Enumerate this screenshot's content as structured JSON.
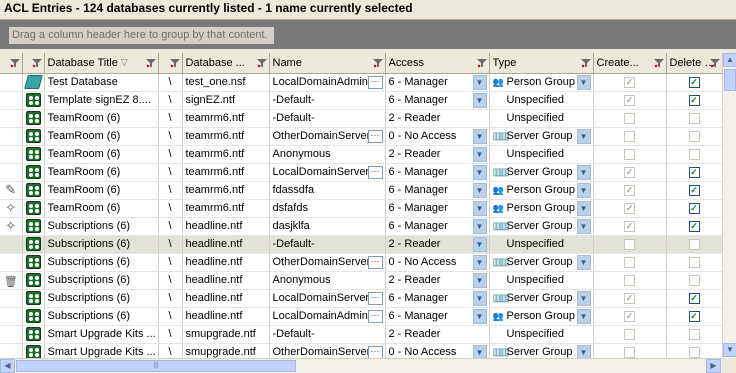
{
  "title": "ACL Entries - 124 databases currently listed - 1 name currently selected",
  "group_panel": {
    "placeholder": "Drag a column header here to group by that content."
  },
  "columns": [
    {
      "key": "marker",
      "label": ""
    },
    {
      "key": "icon",
      "label": ""
    },
    {
      "key": "db_title",
      "label": "Database Title"
    },
    {
      "key": "sep",
      "label": ""
    },
    {
      "key": "db_file",
      "label": "Database ..."
    },
    {
      "key": "name",
      "label": "Name"
    },
    {
      "key": "access",
      "label": "Access"
    },
    {
      "key": "type",
      "label": "Type"
    },
    {
      "key": "create",
      "label": "Create..."
    },
    {
      "key": "delete",
      "label": "Delete D..."
    }
  ],
  "rows": [
    {
      "marker": "",
      "icon": "db-teal",
      "db_title": "Test Database",
      "sep": "\\",
      "db_file": "test_one.nsf",
      "name": "LocalDomainAdmins",
      "name_btn": true,
      "access": "6 - Manager",
      "access_dd": true,
      "type": "Person Group",
      "type_icon": "person",
      "type_dd": true,
      "create": "checked-disabled",
      "delete": "checked"
    },
    {
      "marker": "",
      "icon": "db-green",
      "db_title": "Template signEZ 8....",
      "sep": "\\",
      "db_file": "signEZ.ntf",
      "name": "-Default-",
      "name_btn": false,
      "access": "6 - Manager",
      "access_dd": true,
      "type": "Unspecified",
      "type_icon": "",
      "type_dd": false,
      "create": "checked-disabled",
      "delete": "checked"
    },
    {
      "marker": "",
      "icon": "db-green",
      "db_title": "TeamRoom (6)",
      "sep": "\\",
      "db_file": "teamrm6.ntf",
      "name": "-Default-",
      "name_btn": false,
      "access": "2 - Reader",
      "access_dd": false,
      "type": "Unspecified",
      "type_icon": "",
      "type_dd": false,
      "create": "unchecked-disabled",
      "delete": "unchecked-disabled"
    },
    {
      "marker": "",
      "icon": "db-green",
      "db_title": "TeamRoom (6)",
      "sep": "\\",
      "db_file": "teamrm6.ntf",
      "name": "OtherDomainServers",
      "name_btn": true,
      "access": "0 - No Access",
      "access_dd": true,
      "type": "Server Group",
      "type_icon": "server",
      "type_dd": true,
      "create": "unchecked-disabled",
      "delete": "unchecked-disabled"
    },
    {
      "marker": "",
      "icon": "db-green",
      "db_title": "TeamRoom (6)",
      "sep": "\\",
      "db_file": "teamrm6.ntf",
      "name": "Anonymous",
      "name_btn": false,
      "access": "2 - Reader",
      "access_dd": true,
      "type": "Unspecified",
      "type_icon": "",
      "type_dd": false,
      "create": "unchecked-disabled",
      "delete": "unchecked-disabled"
    },
    {
      "marker": "",
      "icon": "db-green",
      "db_title": "TeamRoom (6)",
      "sep": "\\",
      "db_file": "teamrm6.ntf",
      "name": "LocalDomainServers",
      "name_btn": true,
      "access": "6 - Manager",
      "access_dd": true,
      "type": "Server Group",
      "type_icon": "server",
      "type_dd": true,
      "create": "checked-disabled",
      "delete": "checked"
    },
    {
      "marker": "pencil",
      "icon": "db-green",
      "db_title": "TeamRoom (6)",
      "sep": "\\",
      "db_file": "teamrm6.ntf",
      "name": "fdassdfa",
      "name_btn": false,
      "access": "6 - Manager",
      "access_dd": true,
      "type": "Person Group",
      "type_icon": "person",
      "type_dd": true,
      "create": "checked-disabled",
      "delete": "checked"
    },
    {
      "marker": "star",
      "icon": "db-green",
      "db_title": "TeamRoom (6)",
      "sep": "\\",
      "db_file": "teamrm6.ntf",
      "name": "dsfafds",
      "name_btn": false,
      "access": "6 - Manager",
      "access_dd": true,
      "type": "Person Group",
      "type_icon": "person",
      "type_dd": true,
      "create": "checked-disabled",
      "delete": "checked"
    },
    {
      "marker": "star",
      "icon": "db-green",
      "db_title": "Subscriptions (6)",
      "sep": "\\",
      "db_file": "headline.ntf",
      "name": "dasjklfa",
      "name_btn": false,
      "access": "6 - Manager",
      "access_dd": true,
      "type": "Server Group",
      "type_icon": "server",
      "type_dd": true,
      "create": "checked-disabled",
      "delete": "checked"
    },
    {
      "marker": "",
      "icon": "db-green",
      "db_title": "Subscriptions (6)",
      "sep": "\\",
      "db_file": "headline.ntf",
      "name": "-Default-",
      "name_btn": false,
      "access": "2 - Reader",
      "access_dd": true,
      "type": "Unspecified",
      "type_icon": "",
      "type_dd": false,
      "create": "unchecked-disabled",
      "delete": "unchecked-disabled",
      "selected": true
    },
    {
      "marker": "",
      "icon": "db-green",
      "db_title": "Subscriptions (6)",
      "sep": "\\",
      "db_file": "headline.ntf",
      "name": "OtherDomainServers",
      "name_btn": true,
      "access": "0 - No Access",
      "access_dd": true,
      "type": "Server Group",
      "type_icon": "server",
      "type_dd": true,
      "create": "unchecked-disabled",
      "delete": "unchecked-disabled"
    },
    {
      "marker": "trash",
      "icon": "db-green",
      "db_title": "Subscriptions (6)",
      "sep": "\\",
      "db_file": "headline.ntf",
      "name": "Anonymous",
      "name_btn": false,
      "access": "2 - Reader",
      "access_dd": true,
      "type": "Unspecified",
      "type_icon": "",
      "type_dd": false,
      "create": "unchecked-disabled",
      "delete": "unchecked-disabled"
    },
    {
      "marker": "",
      "icon": "db-green",
      "db_title": "Subscriptions (6)",
      "sep": "\\",
      "db_file": "headline.ntf",
      "name": "LocalDomainServers",
      "name_btn": true,
      "access": "6 - Manager",
      "access_dd": true,
      "type": "Server Group",
      "type_icon": "server",
      "type_dd": true,
      "create": "checked-disabled",
      "delete": "checked"
    },
    {
      "marker": "",
      "icon": "db-green",
      "db_title": "Subscriptions (6)",
      "sep": "\\",
      "db_file": "headline.ntf",
      "name": "LocalDomainAdmins",
      "name_btn": true,
      "access": "6 - Manager",
      "access_dd": true,
      "type": "Person Group",
      "type_icon": "person",
      "type_dd": true,
      "create": "checked-disabled",
      "delete": "checked"
    },
    {
      "marker": "",
      "icon": "db-green",
      "db_title": "Smart Upgrade Kits ...",
      "sep": "\\",
      "db_file": "smupgrade.ntf",
      "name": "-Default-",
      "name_btn": false,
      "access": "2 - Reader",
      "access_dd": false,
      "type": "Unspecified",
      "type_icon": "",
      "type_dd": false,
      "create": "unchecked-disabled",
      "delete": "unchecked-disabled"
    },
    {
      "marker": "",
      "icon": "db-green",
      "db_title": "Smart Upgrade Kits ...",
      "sep": "\\",
      "db_file": "smupgrade.ntf",
      "name": "OtherDomainServers",
      "name_btn": true,
      "access": "0 - No Access",
      "access_dd": true,
      "type": "Server Group",
      "type_icon": "server",
      "type_dd": true,
      "create": "unchecked-disabled",
      "delete": "unchecked-disabled"
    }
  ]
}
